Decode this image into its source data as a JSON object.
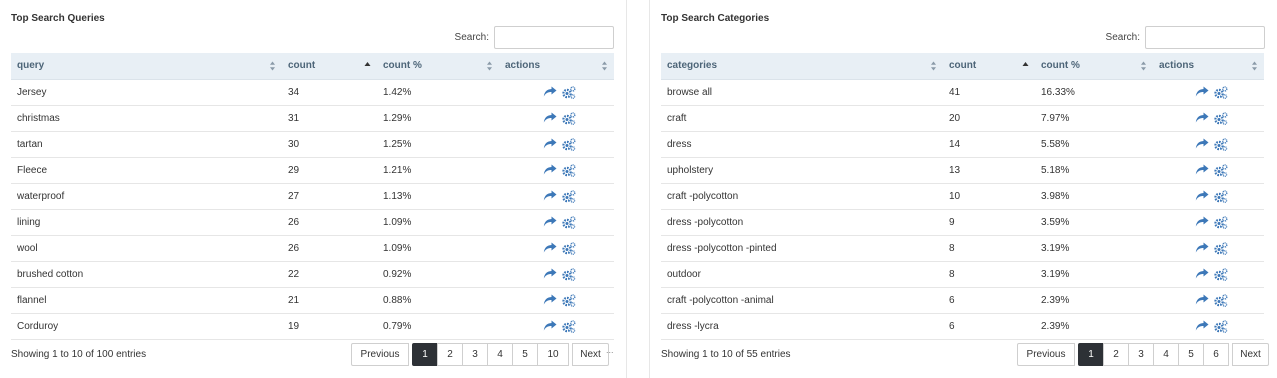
{
  "left": {
    "title": "Top Search Queries",
    "search_label": "Search:",
    "search_value": "",
    "columns": [
      "query",
      "count",
      "count %",
      "actions"
    ],
    "rows": [
      {
        "name": "Jersey",
        "count": "34",
        "pct": "1.42%"
      },
      {
        "name": "christmas",
        "count": "31",
        "pct": "1.29%"
      },
      {
        "name": "tartan",
        "count": "30",
        "pct": "1.25%"
      },
      {
        "name": "Fleece",
        "count": "29",
        "pct": "1.21%"
      },
      {
        "name": "waterproof",
        "count": "27",
        "pct": "1.13%"
      },
      {
        "name": "lining",
        "count": "26",
        "pct": "1.09%"
      },
      {
        "name": "wool",
        "count": "26",
        "pct": "1.09%"
      },
      {
        "name": "brushed cotton",
        "count": "22",
        "pct": "0.92%"
      },
      {
        "name": "flannel",
        "count": "21",
        "pct": "0.88%"
      },
      {
        "name": "Corduroy",
        "count": "19",
        "pct": "0.79%"
      }
    ],
    "info": "Showing 1 to 10 of 100 entries",
    "pagination": {
      "previous": "Previous",
      "pages": [
        "1",
        "2",
        "3",
        "4",
        "5",
        "10"
      ],
      "next": "Next",
      "active": "1"
    },
    "trailing": "..."
  },
  "right": {
    "title": "Top Search Categories",
    "search_label": "Search:",
    "search_value": "",
    "columns": [
      "categories",
      "count",
      "count %",
      "actions"
    ],
    "rows": [
      {
        "name": "browse all",
        "count": "41",
        "pct": "16.33%"
      },
      {
        "name": "craft",
        "count": "20",
        "pct": "7.97%"
      },
      {
        "name": "dress",
        "count": "14",
        "pct": "5.58%"
      },
      {
        "name": "upholstery",
        "count": "13",
        "pct": "5.18%"
      },
      {
        "name": "craft -polycotton",
        "count": "10",
        "pct": "3.98%"
      },
      {
        "name": "dress -polycotton",
        "count": "9",
        "pct": "3.59%"
      },
      {
        "name": "dress -polycotton -pinted",
        "count": "8",
        "pct": "3.19%"
      },
      {
        "name": "outdoor",
        "count": "8",
        "pct": "3.19%"
      },
      {
        "name": "craft -polycotton -animal",
        "count": "6",
        "pct": "2.39%"
      },
      {
        "name": "dress -lycra",
        "count": "6",
        "pct": "2.39%"
      }
    ],
    "info": "Showing 1 to 10 of 55 entries",
    "pagination": {
      "previous": "Previous",
      "pages": [
        "1",
        "2",
        "3",
        "4",
        "5",
        "6"
      ],
      "next": "Next",
      "active": "1"
    }
  },
  "icons": {
    "open": "share-arrow-icon",
    "settings": "gears-icon",
    "sort": "sort-icon",
    "sort_active": "sort-asc-icon"
  },
  "colors": {
    "header_bg": "#e8eff5",
    "header_text": "#4d6578",
    "icon_blue": "#3d78b8",
    "active_page": "#2d3136"
  }
}
